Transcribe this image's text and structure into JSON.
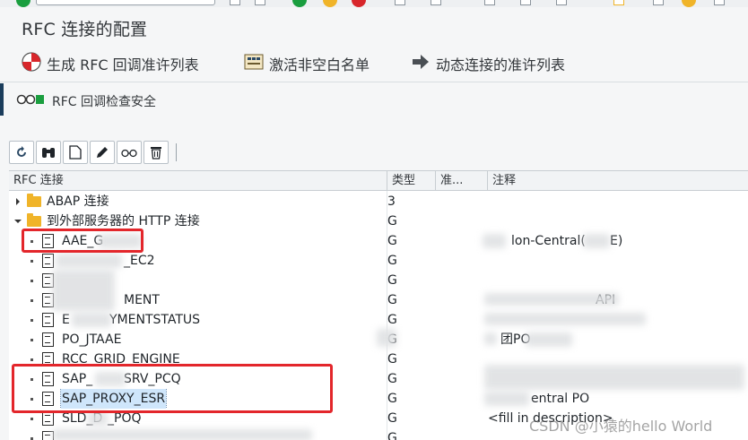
{
  "window": {
    "title": "RFC 连接的配置"
  },
  "app_toolbar": [
    {
      "id": "generate",
      "label": "生成 RFC 回调准许列表",
      "icon": "generate-icon"
    },
    {
      "id": "activate",
      "label": "激活非空白名单",
      "icon": "activate-icon"
    },
    {
      "id": "dynamic",
      "label": "动态连接的准许列表",
      "icon": "arrow-right-icon"
    }
  ],
  "security": {
    "label": "RFC 回调检查安全",
    "icon": "traffic-light-icon",
    "color": "#1a9e3f"
  },
  "tree_toolbar": [
    "refresh-icon",
    "binoculars-icon",
    "document-icon",
    "pencil-icon",
    "glasses-icon",
    "trash-icon"
  ],
  "tree": {
    "columns": {
      "name": "RFC 连接",
      "type": "类型",
      "allow": "准...",
      "note": "注释"
    },
    "rows": [
      {
        "kind": "folder",
        "expanded": false,
        "name": "ABAP 连接",
        "type": "3",
        "note": ""
      },
      {
        "kind": "folder",
        "expanded": true,
        "name": "到外部服务器的 HTTP 连接",
        "type": "G",
        "note": ""
      },
      {
        "kind": "doc",
        "name": "AAE_G",
        "type": "G",
        "note": "lon-Central(",
        "note_end": "E)"
      },
      {
        "kind": "doc",
        "name": "_EC2",
        "type": "G",
        "note": ""
      },
      {
        "kind": "doc",
        "name": "",
        "type": "G",
        "note": ""
      },
      {
        "kind": "doc",
        "name": "MENT",
        "type": "G",
        "note": "API"
      },
      {
        "kind": "doc",
        "name": "E",
        "name_end": "YMENTSTATUS",
        "type": "G",
        "note": ""
      },
      {
        "kind": "doc",
        "name": "PO_JTAAE",
        "type": "G",
        "note": "团PO"
      },
      {
        "kind": "doc",
        "name": "RCC_GRID_ENGINE",
        "type": "G",
        "note": ""
      },
      {
        "kind": "doc",
        "name": "SAP_",
        "name_end": "SRV_PCQ",
        "type": "G",
        "note": ""
      },
      {
        "kind": "doc",
        "name": "SAP_PROXY_ESR",
        "type": "G",
        "note": "entral PO",
        "selected": true
      },
      {
        "kind": "doc",
        "name": "SLD_D",
        "name_end": "_POQ",
        "type": "G",
        "note": "<fill in description>"
      },
      {
        "kind": "doc",
        "name": "",
        "type": "G",
        "note": ""
      }
    ]
  },
  "watermark": "CSDN @小猿的hello World",
  "colors": {
    "highlight_box": "#e3262b",
    "selection": "#cfe6fb",
    "folder": "#f0b429"
  }
}
